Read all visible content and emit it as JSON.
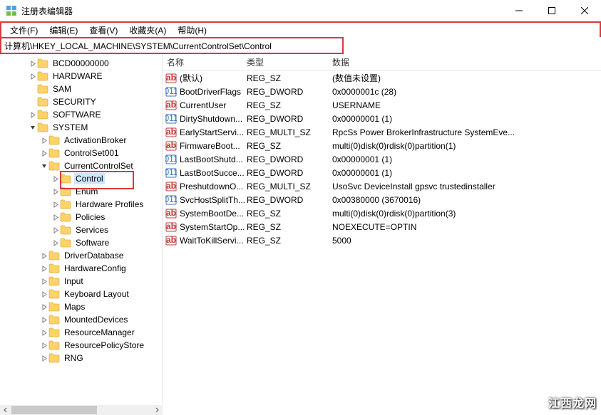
{
  "title": "注册表编辑器",
  "menu": {
    "file": "文件(F)",
    "edit": "编辑(E)",
    "view": "查看(V)",
    "fav": "收藏夹(A)",
    "help": "帮助(H)"
  },
  "address": "计算机\\HKEY_LOCAL_MACHINE\\SYSTEM\\CurrentControlSet\\Control",
  "tree": [
    {
      "indent": 2,
      "expand": "closed",
      "label": "BCD00000000"
    },
    {
      "indent": 2,
      "expand": "closed",
      "label": "HARDWARE"
    },
    {
      "indent": 2,
      "expand": "none",
      "label": "SAM"
    },
    {
      "indent": 2,
      "expand": "none",
      "label": "SECURITY"
    },
    {
      "indent": 2,
      "expand": "closed",
      "label": "SOFTWARE"
    },
    {
      "indent": 2,
      "expand": "open",
      "label": "SYSTEM"
    },
    {
      "indent": 3,
      "expand": "closed",
      "label": "ActivationBroker"
    },
    {
      "indent": 3,
      "expand": "closed",
      "label": "ControlSet001"
    },
    {
      "indent": 3,
      "expand": "open",
      "label": "CurrentControlSet"
    },
    {
      "indent": 4,
      "expand": "closed",
      "label": "Control",
      "selected": true,
      "highlighted": true
    },
    {
      "indent": 4,
      "expand": "closed",
      "label": "Enum"
    },
    {
      "indent": 4,
      "expand": "closed",
      "label": "Hardware Profiles"
    },
    {
      "indent": 4,
      "expand": "closed",
      "label": "Policies"
    },
    {
      "indent": 4,
      "expand": "closed",
      "label": "Services"
    },
    {
      "indent": 4,
      "expand": "closed",
      "label": "Software"
    },
    {
      "indent": 3,
      "expand": "closed",
      "label": "DriverDatabase"
    },
    {
      "indent": 3,
      "expand": "closed",
      "label": "HardwareConfig"
    },
    {
      "indent": 3,
      "expand": "closed",
      "label": "Input"
    },
    {
      "indent": 3,
      "expand": "closed",
      "label": "Keyboard Layout"
    },
    {
      "indent": 3,
      "expand": "closed",
      "label": "Maps"
    },
    {
      "indent": 3,
      "expand": "closed",
      "label": "MountedDevices"
    },
    {
      "indent": 3,
      "expand": "closed",
      "label": "ResourceManager"
    },
    {
      "indent": 3,
      "expand": "closed",
      "label": "ResourcePolicyStore"
    },
    {
      "indent": 3,
      "expand": "closed",
      "label": "RNG"
    }
  ],
  "columns": {
    "name": "名称",
    "type": "类型",
    "data": "数据"
  },
  "values": [
    {
      "icon": "sz",
      "name": "(默认)",
      "type": "REG_SZ",
      "data": "(数值未设置)"
    },
    {
      "icon": "bin",
      "name": "BootDriverFlags",
      "type": "REG_DWORD",
      "data": "0x0000001c (28)"
    },
    {
      "icon": "sz",
      "name": "CurrentUser",
      "type": "REG_SZ",
      "data": "USERNAME"
    },
    {
      "icon": "bin",
      "name": "DirtyShutdown...",
      "type": "REG_DWORD",
      "data": "0x00000001 (1)"
    },
    {
      "icon": "sz",
      "name": "EarlyStartServi...",
      "type": "REG_MULTI_SZ",
      "data": "RpcSs Power BrokerInfrastructure SystemEve..."
    },
    {
      "icon": "sz",
      "name": "FirmwareBoot...",
      "type": "REG_SZ",
      "data": "multi(0)disk(0)rdisk(0)partition(1)"
    },
    {
      "icon": "bin",
      "name": "LastBootShutd...",
      "type": "REG_DWORD",
      "data": "0x00000001 (1)"
    },
    {
      "icon": "bin",
      "name": "LastBootSucce...",
      "type": "REG_DWORD",
      "data": "0x00000001 (1)"
    },
    {
      "icon": "sz",
      "name": "PreshutdownO...",
      "type": "REG_MULTI_SZ",
      "data": "UsoSvc DeviceInstall gpsvc trustedinstaller"
    },
    {
      "icon": "bin",
      "name": "SvcHostSplitTh...",
      "type": "REG_DWORD",
      "data": "0x00380000 (3670016)"
    },
    {
      "icon": "sz",
      "name": "SystemBootDe...",
      "type": "REG_SZ",
      "data": "multi(0)disk(0)rdisk(0)partition(3)"
    },
    {
      "icon": "sz",
      "name": "SystemStartOp...",
      "type": "REG_SZ",
      "data": " NOEXECUTE=OPTIN"
    },
    {
      "icon": "sz",
      "name": "WaitToKillServi...",
      "type": "REG_SZ",
      "data": "5000"
    }
  ],
  "watermark": "江西龙网"
}
